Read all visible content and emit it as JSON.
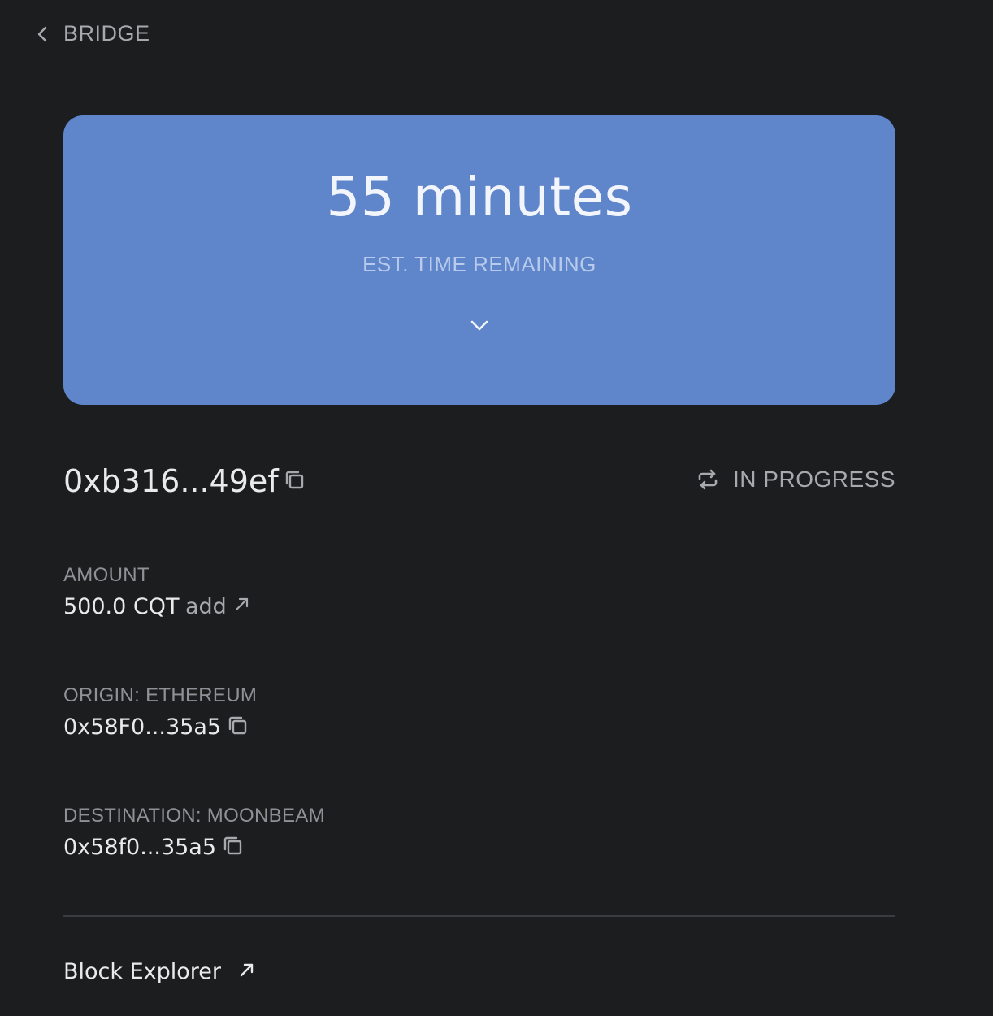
{
  "header": {
    "back_label": "BRIDGE"
  },
  "status_card": {
    "eta_value": "55 minutes",
    "eta_label": "EST. TIME REMAINING",
    "background_color": "#5f85cb"
  },
  "transaction": {
    "hash": "0xb316...49ef",
    "status": "IN PROGRESS"
  },
  "amount": {
    "label": "AMOUNT",
    "value": "500.0 CQT",
    "add_label": "add"
  },
  "origin": {
    "label": "ORIGIN: ETHEREUM",
    "address": "0x58F0...35a5"
  },
  "destination": {
    "label": "DESTINATION: MOONBEAM",
    "address": "0x58f0...35a5"
  },
  "footer": {
    "explorer_label": "Block Explorer"
  },
  "icons": {
    "back": "chevron-left-icon",
    "expand": "chevron-down-icon",
    "copy": "copy-icon",
    "status": "repeat-icon",
    "external": "arrow-up-right-icon"
  }
}
